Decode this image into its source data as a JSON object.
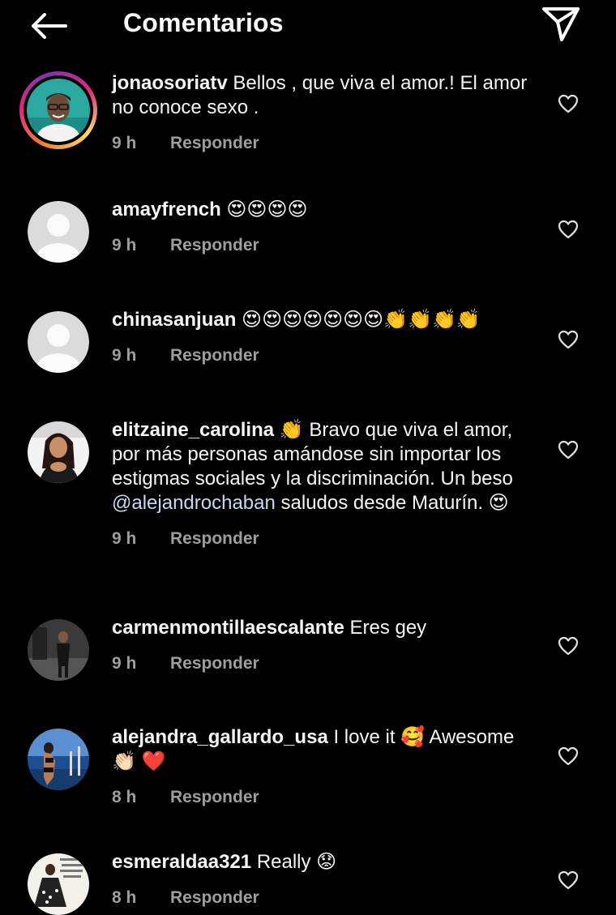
{
  "header": {
    "title": "Comentarios",
    "back_icon": "arrow-left-icon",
    "share_icon": "paper-plane-icon"
  },
  "reply_label": "Responder",
  "comments": [
    {
      "username": "jonaosoriatv",
      "text": "Bellos , que viva el amor.! El amor no conoce sexo .",
      "time": "9 h",
      "avatar": "photo-story-ring"
    },
    {
      "username": "amayfrench",
      "text": "😍😍😍😍",
      "time": "9 h",
      "avatar": "default"
    },
    {
      "username": "chinasanjuan",
      "text": "😍😍😍😍😍😍😍👏👏👏👏",
      "time": "9 h",
      "avatar": "default"
    },
    {
      "username": "elitzaine_carolina",
      "text_before_mention": "👏 Bravo que viva el amor, por más personas amándose sin importar los estigmas sociales y la discriminación. Un beso",
      "mention": "@alejandrochaban",
      "text_after_mention": "saludos desde Maturín. 😍",
      "time": "9 h",
      "avatar": "photo"
    },
    {
      "username": "carmenmontillaescalante",
      "text": "Eres gey",
      "time": "9 h",
      "avatar": "photo"
    },
    {
      "username": "alejandra_gallardo_usa",
      "text": "I love it 🥰 Awesome 👏🏻 ❤️",
      "time": "8 h",
      "avatar": "photo"
    },
    {
      "username": "esmeraldaa321",
      "text": "Really 😟",
      "time": "8 h",
      "avatar": "photo"
    }
  ],
  "colors": {
    "background": "#000000",
    "text": "#f5f5f5",
    "meta": "#9e9e9e",
    "mention": "#c7d8f2"
  }
}
